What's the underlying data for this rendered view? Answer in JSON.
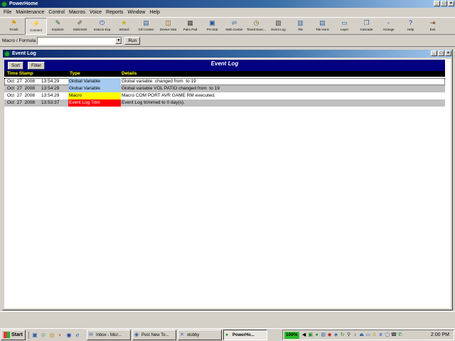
{
  "app": {
    "title": "PowerHome"
  },
  "menu": [
    "File",
    "Maintenance",
    "Control",
    "Macros",
    "Voice",
    "Reports",
    "Window",
    "Help"
  ],
  "toolbar": [
    {
      "label": "Finish",
      "icon": "finish-icon",
      "glyph": "⚑",
      "color": "#d89a00"
    },
    {
      "label": "Connect",
      "icon": "connect-icon",
      "glyph": "⚡",
      "color": "#c03020"
    },
    {
      "label": "Explorer",
      "icon": "explorer-icon",
      "glyph": "✎",
      "color": "#206020"
    },
    {
      "label": "Multi-Edit",
      "icon": "multi-edit-icon",
      "glyph": "✐",
      "color": "#604020"
    },
    {
      "label": "Instcon Exp",
      "icon": "insteon-explorer-icon",
      "glyph": "⏻",
      "color": "#2040c0"
    },
    {
      "label": "Wizard",
      "icon": "wizard-icon",
      "glyph": "★",
      "color": "#d0b000"
    },
    {
      "label": "Ctrl Center",
      "icon": "control-center-icon",
      "glyph": "▤",
      "color": "#3060a0"
    },
    {
      "label": "Device Stat",
      "icon": "device-status-icon",
      "glyph": "◫",
      "color": "#806000"
    },
    {
      "label": "Palm Pad",
      "icon": "palm-pad-icon",
      "glyph": "▦",
      "color": "#404040"
    },
    {
      "label": "PH Stat",
      "icon": "ph-status-icon",
      "glyph": "▣",
      "color": "#2050a0"
    },
    {
      "label": "Web Center",
      "icon": "web-center-icon",
      "glyph": "⇌",
      "color": "#6080a0"
    },
    {
      "label": "Timed Exec...",
      "icon": "timed-exec-icon",
      "glyph": "◷",
      "color": "#806020"
    },
    {
      "label": "Event Log",
      "icon": "event-log-icon",
      "glyph": "▧",
      "color": "#404040"
    },
    {
      "label": "Tile",
      "icon": "tile-icon",
      "glyph": "▥",
      "color": "#3060a0"
    },
    {
      "label": "Tile Horiz",
      "icon": "tile-horizontal-icon",
      "glyph": "▤",
      "color": "#3060a0"
    },
    {
      "label": "Layer",
      "icon": "layer-icon",
      "glyph": "▭",
      "color": "#3060a0"
    },
    {
      "label": "Cascade",
      "icon": "cascade-icon",
      "glyph": "❐",
      "color": "#3060a0"
    },
    {
      "label": "Arrange",
      "icon": "arrange-icon",
      "glyph": "▫",
      "color": "#3060a0"
    },
    {
      "label": "Help",
      "icon": "help-icon",
      "glyph": "?",
      "color": "#2040a0"
    },
    {
      "label": "Exit",
      "icon": "exit-icon",
      "glyph": "⇥",
      "color": "#803010"
    }
  ],
  "macrobar": {
    "label": "Macro / Formula",
    "value": "",
    "run_label": "Run"
  },
  "eventlog": {
    "window_title": "Event Log",
    "header_title": "Event Log",
    "sort_label": "Sort",
    "filter_label": "Filter",
    "columns": [
      "Time Stamp",
      "Type",
      "Details"
    ],
    "rows": [
      {
        "timestamp": "Oct  27  2008     13:54:29",
        "type": "Global Variable",
        "type_color": "#a6caf0",
        "details": "Global variable  changed from  to 19"
      },
      {
        "timestamp": "Oct  27  2008     13:54:29",
        "type": "Global Variable",
        "type_color": "#a6caf0",
        "details": "Global variable VOL PATIO changed from  to 19"
      },
      {
        "timestamp": "Oct  27  2008     13:54:29",
        "type": "Macro",
        "type_color": "#ffff00",
        "details": "Macro COM PORT AVR GAME RM executed."
      },
      {
        "timestamp": "Oct  27  2008     13:53:37",
        "type": "Event Log Trim",
        "type_color": "#ff0000",
        "details": "Event Log trimmed to 0 day(s)."
      }
    ]
  },
  "taskbar": {
    "start_label": "Start",
    "tasks": [
      {
        "label": "Inbox - Micr...",
        "icon": "outlook-icon",
        "glyph": "✉"
      },
      {
        "label": "Post New To...",
        "icon": "browser-icon",
        "glyph": "◉"
      },
      {
        "label": "xlobby",
        "icon": "xlobby-icon",
        "glyph": "✕"
      },
      {
        "label": "PowerHo...",
        "icon": "powerhome-icon",
        "glyph": "●",
        "active": true
      }
    ],
    "battery": "100%",
    "clock": "2:00 PM"
  }
}
